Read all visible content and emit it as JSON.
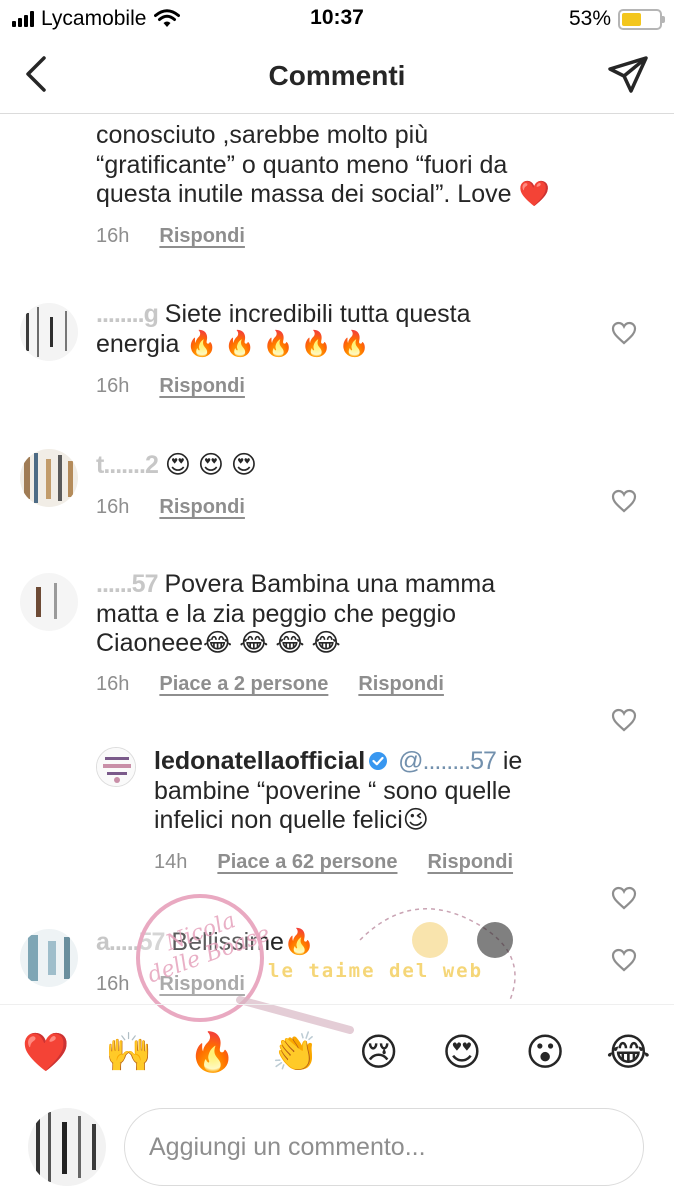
{
  "status_bar": {
    "carrier": "Lycamobile",
    "time": "10:37",
    "battery": "53%",
    "battery_level": 0.53
  },
  "header": {
    "title": "Commenti",
    "back_icon": "chevron-left-icon",
    "send_icon": "paper-plane-icon"
  },
  "comments": [
    {
      "text_line1": "conosciuto ,sarebbe molto più",
      "text_line2": "“gratificante” o quanto meno “fuori da",
      "text_line3": "questa inutile massa dei social”. Love ❤️",
      "time": "16h",
      "reply": "Rispondi"
    },
    {
      "user": "........g",
      "text": "Siete incredibili tutta questa",
      "text_line2": "energia 🔥 🔥 🔥 🔥 🔥",
      "time": "16h",
      "reply": "Rispondi"
    },
    {
      "user": "t.......2",
      "text": "😍 😍 😍",
      "time": "16h",
      "reply": "Rispondi"
    },
    {
      "user": "......57",
      "text": "Povera Bambina una mamma",
      "text_line2": "matta e la zia peggio che peggio",
      "text_line3": "Ciaoneee😂 😂 😂 😂",
      "time": "16h",
      "likes": "Piace a 2 persone",
      "reply": "Rispondi"
    },
    {
      "user": "ledonatellaofficial",
      "mention": "@........57",
      "text": "ie",
      "text_line2": "bambine “poverine “ sono quelle",
      "text_line3": "infelici non quelle felici😉",
      "time": "14h",
      "likes": "Piace a 62 persone",
      "reply": "Rispondi"
    },
    {
      "user": "a.....57",
      "text": "Bellissime🔥",
      "time": "16h",
      "reply": "Rispondi"
    }
  ],
  "watermark": {
    "text_left": "Nicola delle Boase",
    "text_right": "le taime del web"
  },
  "emoji_bar": [
    "❤️",
    "🙌",
    "🔥",
    "👏",
    "😢",
    "😍",
    "😮",
    "😂"
  ],
  "composer": {
    "placeholder": "Aggiungi un commento..."
  }
}
